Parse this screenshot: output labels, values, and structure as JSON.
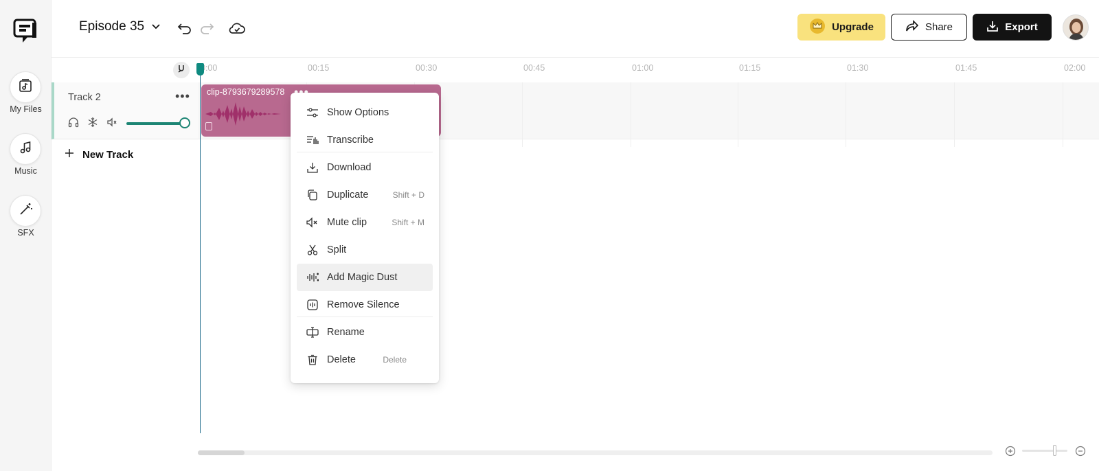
{
  "app": {
    "colors": {
      "accent": "#0f8a80",
      "clip": "#b8698f",
      "upgrade": "#f9e27e",
      "export_bg": "#131313"
    }
  },
  "sidebar": {
    "items": [
      {
        "label": "My Files",
        "icon": "music-file-icon"
      },
      {
        "label": "Music",
        "icon": "music-note-icon"
      },
      {
        "label": "SFX",
        "icon": "magic-wand-icon"
      }
    ]
  },
  "header": {
    "episode_title": "Episode 35",
    "upgrade_label": "Upgrade",
    "share_label": "Share",
    "export_label": "Export"
  },
  "ruler": {
    "ticks": [
      "0:00",
      "00:15",
      "00:30",
      "00:45",
      "01:00",
      "01:15",
      "01:30",
      "01:45",
      "02:00"
    ]
  },
  "track": {
    "name": "Track 2",
    "more_label": "•••",
    "volume": 1.0
  },
  "new_track_label": "New Track",
  "clip": {
    "name": "clip-8793679289578",
    "dots": "•••"
  },
  "context_menu": {
    "items": [
      {
        "label": "Show Options",
        "shortcut": "",
        "icon": "sliders-icon"
      },
      {
        "label": "Transcribe",
        "shortcut": "",
        "icon": "transcribe-icon"
      },
      {
        "label": "Download",
        "shortcut": "",
        "icon": "download-icon"
      },
      {
        "label": "Duplicate",
        "shortcut": "Shift + D",
        "icon": "duplicate-icon"
      },
      {
        "label": "Mute clip",
        "shortcut": "Shift + M",
        "icon": "mute-icon"
      },
      {
        "label": "Split",
        "shortcut": "",
        "icon": "scissors-icon"
      },
      {
        "label": "Add Magic Dust",
        "shortcut": "",
        "icon": "magic-dust-icon"
      },
      {
        "label": "Remove Silence",
        "shortcut": "",
        "icon": "remove-silence-icon"
      },
      {
        "label": "Rename",
        "shortcut": "",
        "icon": "rename-icon"
      },
      {
        "label": "Delete",
        "shortcut": "Delete",
        "icon": "trash-icon"
      }
    ]
  },
  "zoom": {
    "level": 0.7
  }
}
